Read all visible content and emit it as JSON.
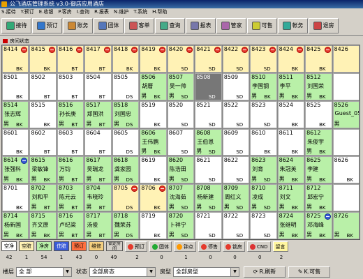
{
  "window": {
    "title": "公飞酒店管理系统 v3.0-御店应用酒店"
  },
  "menu": [
    "S.接待",
    "Y.预订",
    "E.收银",
    "P.客房",
    "I.查询",
    "R.报表",
    "N.维护",
    "T.系统",
    "H.帮助"
  ],
  "toolbar": [
    {
      "label": "接待",
      "icon": "reception-icon"
    },
    {
      "label": "预订",
      "icon": "booking-icon"
    },
    {
      "label": "账务",
      "icon": "account-icon"
    },
    {
      "label": "团体",
      "icon": "group-icon"
    },
    {
      "label": "客单",
      "icon": "bill-icon"
    },
    {
      "label": "查询",
      "icon": "search-icon"
    },
    {
      "label": "报表",
      "icon": "report-icon"
    },
    {
      "label": "管家",
      "icon": "butler-icon"
    },
    {
      "label": "可售",
      "icon": "available-icon"
    },
    {
      "label": "帐务",
      "icon": "ledger-icon"
    },
    {
      "label": "退房",
      "icon": "checkout-icon"
    }
  ],
  "section_title": "房间状态",
  "rooms": [
    {
      "num": "8414",
      "status": "dirty",
      "type": "BK",
      "badge": "red"
    },
    {
      "num": "8415",
      "status": "dirty",
      "type": "BK",
      "badge": "red"
    },
    {
      "num": "8416",
      "status": "dirty",
      "type": "BT",
      "badge": "red"
    },
    {
      "num": "8417",
      "status": "dirty",
      "type": "BT",
      "badge": "red"
    },
    {
      "num": "8418",
      "status": "dirty",
      "type": "BK",
      "badge": "red"
    },
    {
      "num": "8419",
      "status": "dirty",
      "type": "BK",
      "badge": "red"
    },
    {
      "num": "8420",
      "status": "dirty",
      "type": "SD",
      "badge": "red"
    },
    {
      "num": "8421",
      "status": "dirty",
      "type": "SD",
      "badge": "red"
    },
    {
      "num": "8422",
      "status": "dirty",
      "type": "SD",
      "badge": "red"
    },
    {
      "num": "8423",
      "status": "dirty",
      "type": "SD",
      "badge": "red"
    },
    {
      "num": "8424",
      "status": "dirty",
      "type": "BK",
      "badge": "red"
    },
    {
      "num": "8425",
      "status": "dirty",
      "type": "BK",
      "badge": "red"
    },
    {
      "num": "8426",
      "status": "dirty",
      "type": "",
      "badge": ""
    },
    {
      "num": "8501",
      "status": "empty",
      "type": "BK"
    },
    {
      "num": "8502",
      "status": "empty",
      "type": "BT"
    },
    {
      "num": "8503",
      "status": "empty",
      "type": "BT"
    },
    {
      "num": "8504",
      "status": "empty",
      "type": "BT"
    },
    {
      "num": "8505",
      "status": "empty",
      "type": "DS"
    },
    {
      "num": "8506",
      "status": "occ",
      "guest": "胡厝",
      "sex": "男",
      "type": "BK"
    },
    {
      "num": "8507",
      "status": "occ",
      "guest": "吴一帅",
      "sex": "男",
      "type": "SD"
    },
    {
      "num": "8508",
      "status": "sel",
      "type": "SD"
    },
    {
      "num": "8509",
      "status": "empty",
      "type": "SD"
    },
    {
      "num": "8510",
      "status": "occ",
      "guest": "李国钢",
      "sex": "男",
      "type": "BK"
    },
    {
      "num": "8511",
      "status": "occ",
      "guest": "李平",
      "sex": "男",
      "type": "BK"
    },
    {
      "num": "8512",
      "status": "occ",
      "guest": "刘国荣",
      "sex": "男",
      "type": "BK"
    },
    {
      "num": "",
      "status": "empty",
      "type": ""
    },
    {
      "num": "8514",
      "status": "occ",
      "guest": "张志辉",
      "sex": "男",
      "type": "BK"
    },
    {
      "num": "8515",
      "status": "empty",
      "type": "BK"
    },
    {
      "num": "8516",
      "status": "occ",
      "guest": "孙长庚",
      "sex": "男",
      "type": "BT"
    },
    {
      "num": "8517",
      "status": "occ",
      "guest": "郑国洪",
      "sex": "男",
      "type": "BT"
    },
    {
      "num": "8518",
      "status": "occ",
      "guest": "刘国忠",
      "sex": "男",
      "type": "DS"
    },
    {
      "num": "8519",
      "status": "empty",
      "type": "BK"
    },
    {
      "num": "8520",
      "status": "empty",
      "type": "SD"
    },
    {
      "num": "8521",
      "status": "empty",
      "type": "SD"
    },
    {
      "num": "8522",
      "status": "empty",
      "type": "SD"
    },
    {
      "num": "8523",
      "status": "empty",
      "type": "SD"
    },
    {
      "num": "8524",
      "status": "empty",
      "type": "BK"
    },
    {
      "num": "8525",
      "status": "empty",
      "type": "BK"
    },
    {
      "num": "8526",
      "status": "occ",
      "guest": "Guest_05",
      "sex": "男",
      "type": ""
    },
    {
      "num": "8601",
      "status": "empty",
      "type": "BK"
    },
    {
      "num": "8602",
      "status": "empty",
      "type": "BT"
    },
    {
      "num": "8603",
      "status": "empty",
      "type": "BT"
    },
    {
      "num": "8604",
      "status": "empty",
      "type": "BT"
    },
    {
      "num": "8605",
      "status": "empty",
      "type": "DS"
    },
    {
      "num": "8606",
      "status": "occ",
      "guest": "王伟鹏",
      "sex": "男",
      "type": "BK"
    },
    {
      "num": "8607",
      "status": "empty",
      "type": "SD"
    },
    {
      "num": "8608",
      "status": "occ",
      "guest": "王伯恩",
      "sex": "男",
      "type": "SD"
    },
    {
      "num": "8609",
      "status": "empty",
      "type": "SD"
    },
    {
      "num": "8610",
      "status": "empty",
      "type": "BK"
    },
    {
      "num": "8611",
      "status": "empty",
      "type": "BK"
    },
    {
      "num": "8612",
      "status": "occ",
      "guest": "朱俊宇",
      "sex": "男",
      "type": "BK"
    },
    {
      "num": "",
      "status": "empty",
      "type": ""
    },
    {
      "num": "8614",
      "status": "occ",
      "guest": "张强科",
      "sex": "男",
      "type": "BK",
      "badge": "blue"
    },
    {
      "num": "8615",
      "status": "occ",
      "guest": "梁敏锋",
      "sex": "男",
      "type": "BK"
    },
    {
      "num": "8616",
      "status": "occ",
      "guest": "万钧",
      "sex": "男",
      "type": "BT"
    },
    {
      "num": "8617",
      "status": "occ",
      "guest": "吴瑞龙",
      "sex": "男",
      "type": "BT"
    },
    {
      "num": "8618",
      "status": "occ",
      "guest": "龚家园",
      "sex": "男",
      "type": "DS"
    },
    {
      "num": "8619",
      "status": "empty",
      "type": "BK"
    },
    {
      "num": "8620",
      "status": "occ",
      "guest": "陈浩田",
      "sex": "男",
      "type": "SD"
    },
    {
      "num": "8621",
      "status": "empty",
      "type": "SD"
    },
    {
      "num": "8622",
      "status": "empty",
      "type": "SD"
    },
    {
      "num": "8623",
      "status": "occ",
      "guest": "刘育",
      "sex": "男",
      "type": "SD"
    },
    {
      "num": "8624",
      "status": "occ",
      "guest": "朱冠英",
      "sex": "男",
      "type": "BK"
    },
    {
      "num": "8625",
      "status": "occ",
      "guest": "李建",
      "sex": "男",
      "type": "BK"
    },
    {
      "num": "8626",
      "status": "empty",
      "type": "BK"
    },
    {
      "num": "8701",
      "status": "empty",
      "type": "BK"
    },
    {
      "num": "8702",
      "status": "occ",
      "guest": "刘和平",
      "sex": "男",
      "type": "BT"
    },
    {
      "num": "8703",
      "status": "occ",
      "guest": "陈元云",
      "sex": "男",
      "type": "BT"
    },
    {
      "num": "8704",
      "status": "occ",
      "guest": "韦晓玲",
      "sex": "男",
      "type": "BT"
    },
    {
      "num": "8705",
      "status": "dirty",
      "type": "DS",
      "badge": "red"
    },
    {
      "num": "8706",
      "status": "dirty",
      "type": "BK",
      "badge": "red"
    },
    {
      "num": "8707",
      "status": "occ",
      "guest": "沈海茹",
      "sex": "男",
      "type": "SD"
    },
    {
      "num": "8708",
      "status": "occ",
      "guest": "杨新建",
      "sex": "男",
      "type": "SD"
    },
    {
      "num": "8709",
      "status": "occ",
      "guest": "周红义",
      "sex": "男",
      "type": "SD"
    },
    {
      "num": "8710",
      "status": "occ",
      "guest": "凌成",
      "sex": "男",
      "type": "SD"
    },
    {
      "num": "8711",
      "status": "occ",
      "guest": "刘文",
      "sex": "男",
      "type": "BK"
    },
    {
      "num": "8712",
      "status": "occ",
      "guest": "邱宏宁",
      "sex": "男",
      "type": "BK"
    },
    {
      "num": "",
      "status": "empty",
      "type": ""
    },
    {
      "num": "8714",
      "status": "occ",
      "guest": "杨新国",
      "sex": "男",
      "type": "BK"
    },
    {
      "num": "8715",
      "status": "occ",
      "guest": "齐文原",
      "sex": "男",
      "type": "BK"
    },
    {
      "num": "8716",
      "status": "occ",
      "guest": "卢纪梁",
      "sex": "男",
      "type": "BT"
    },
    {
      "num": "8717",
      "status": "occ",
      "guest": "汤俊",
      "sex": "男",
      "type": "BT"
    },
    {
      "num": "8718",
      "status": "occ",
      "guest": "魏荣苏",
      "sex": "男",
      "type": "DS"
    },
    {
      "num": "8719",
      "status": "empty",
      "type": "BK"
    },
    {
      "num": "8720",
      "status": "occ",
      "guest": "卜祥宁",
      "sex": "男",
      "type": "SD"
    },
    {
      "num": "8721",
      "status": "empty",
      "type": "SD"
    },
    {
      "num": "8722",
      "status": "empty",
      "type": "SD"
    },
    {
      "num": "8723",
      "status": "empty",
      "type": "SD"
    },
    {
      "num": "8724",
      "status": "occ",
      "guest": "张继明",
      "sex": "男",
      "type": "BK"
    },
    {
      "num": "8725",
      "status": "occ",
      "guest": "邓海峰",
      "sex": "男",
      "type": "BK",
      "badge": "blue"
    },
    {
      "num": "8726",
      "status": "occ",
      "guest": "",
      "sex": "男",
      "type": "BK"
    }
  ],
  "legend": [
    {
      "label": "空净",
      "count": "42",
      "color": "#ffffff"
    },
    {
      "label": "空脏",
      "count": "1",
      "color": "#fff2b5"
    },
    {
      "label": "净房",
      "count": "54",
      "color": "#b9f0a8"
    },
    {
      "label": "住脏",
      "count": "1",
      "color": "#3a5bd8"
    },
    {
      "label": "预订",
      "count": "43",
      "color": "#ff7040"
    },
    {
      "label": "维修",
      "count": "0",
      "color": "#f5d080"
    }
  ],
  "legend_extra_label": "锁定房间",
  "legend_extra_count": "49",
  "legend_buttons": [
    {
      "label": "预订",
      "count": "2",
      "dot": "#e53a2c"
    },
    {
      "label": "团体",
      "count": "0",
      "dot": "#22aa33"
    },
    {
      "label": "钟点",
      "count": "1",
      "dot": "#ff9900"
    },
    {
      "label": "停售",
      "count": "0",
      "dot": "#e53a2c"
    },
    {
      "label": "锁房",
      "count": "0",
      "dot": "#e53a2c"
    },
    {
      "label": "CND",
      "count": "0",
      "dot": "#d33"
    }
  ],
  "legend_last": {
    "label": "留言",
    "count": "2"
  },
  "filter": {
    "floor_label": "楼层",
    "floor_value": "全  部",
    "status_label": "状态",
    "status_value": "全部房态",
    "type_label": "房型",
    "type_value": "全部房型",
    "refresh_label": "R.刷新",
    "available_label": "K.可售"
  }
}
